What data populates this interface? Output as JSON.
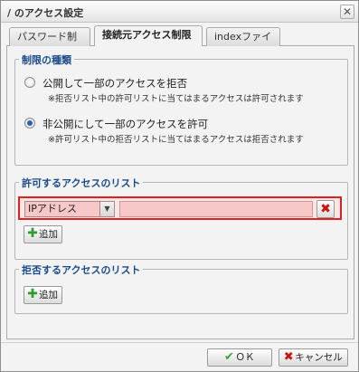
{
  "dialog": {
    "title": "/ のアクセス設定",
    "close_glyph": "✕"
  },
  "tabs": [
    {
      "label": "パスワード制限",
      "active": false
    },
    {
      "label": "接続元アクセス制限",
      "active": true
    },
    {
      "label": "indexファイル",
      "active": false
    }
  ],
  "restriction_type": {
    "legend": "制限の種類",
    "options": [
      {
        "label": "公開して一部のアクセスを拒否",
        "note": "※拒否リスト中の許可リストに当てはまるアクセスは許可されます",
        "checked": false
      },
      {
        "label": "非公開にして一部のアクセスを許可",
        "note": "※許可リスト中の拒否リストに当てはまるアクセスは拒否されます",
        "checked": true
      }
    ]
  },
  "allow_list": {
    "legend": "許可するアクセスのリスト",
    "rule": {
      "type_value": "IPアドレス",
      "type_arrow": "▼",
      "value": "",
      "remove_glyph": "✖"
    },
    "add_label": "追加"
  },
  "deny_list": {
    "legend": "拒否するアクセスのリスト",
    "add_label": "追加"
  },
  "footer": {
    "ok_label": "ＯＫ",
    "cancel_label": "キャンセル"
  },
  "icons": {
    "plus": "✚",
    "check": "✔",
    "x": "✖"
  },
  "colors": {
    "legend": "#1a4a8a",
    "highlight_border": "#e02020",
    "input_error_bg": "#f8c8c8"
  }
}
